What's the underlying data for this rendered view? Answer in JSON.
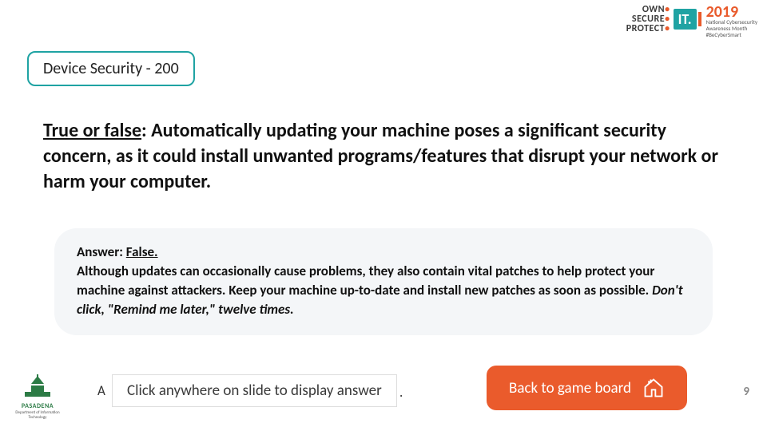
{
  "logo": {
    "line1": "OWN",
    "line2": "SECURE",
    "line3": "PROTECT",
    "it": "IT.",
    "year": "2019",
    "year_sub1": "National Cybersecurity",
    "year_sub2": "Awareness Month",
    "year_sub3": "#BeCyberSmart"
  },
  "category": {
    "label": "Device Security - 200"
  },
  "question": {
    "prefix": "True or false",
    "body": ": Automatically updating your machine poses a significant security concern, as it could install unwanted programs/features that disrupt your network or harm your computer."
  },
  "answer": {
    "label": "Answer: ",
    "value": "False.",
    "body1": "Although updates can occasionally cause problems, they also contain vital patches to help protect your machine against attackers. Keep your machine up-to-date and install new patches as soon as possible. ",
    "body_em": "Don't click, \"Remind me later,\" twelve times."
  },
  "hint": {
    "leading": "A",
    "text": "Click anywhere on slide to display answer",
    "trailing": "."
  },
  "back": {
    "label": "Back to game board"
  },
  "footer_logo": {
    "name": "PASADENA",
    "sub": "Department of Information Technology"
  },
  "page": {
    "number": "9"
  },
  "colors": {
    "accent_orange": "#ea5b2c",
    "accent_teal": "#1fa3a3"
  }
}
